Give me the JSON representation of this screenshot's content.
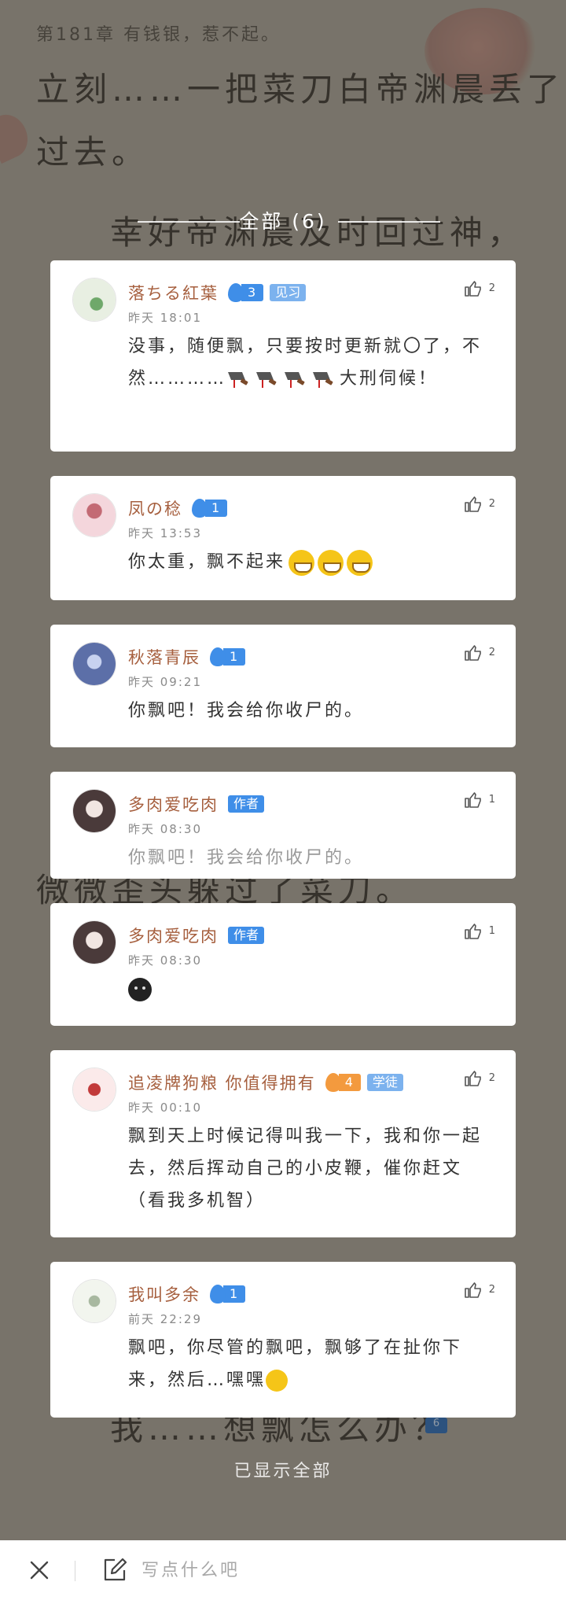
{
  "background": {
    "chapter": "第181章 有钱银，惹不起。",
    "lines": [
      "立刻……一把菜刀白帝渊晨丢了",
      "过去。",
      "幸好帝渊晨及时回过神，"
    ],
    "mid_lines": [
      "微微歪头躲过了菜刀。"
    ],
    "bottom_line": "我……想飘怎么办？",
    "badge_count": "6"
  },
  "header": {
    "title": "全部 (6)"
  },
  "comments": [
    {
      "name": "落ちる紅葉",
      "level": "3",
      "level_color": "blue",
      "tag": "见习",
      "tag_style": "light",
      "time": "昨天 18:01",
      "content": "没事，随便飘，只要按时更新就〇了，不然…………",
      "content_suffix": "大刑伺候！",
      "knives": 4,
      "likes": "2",
      "avatar_colors": [
        "#e8efe2",
        "#6fa86a"
      ]
    },
    {
      "name": "凤の稔",
      "level": "1",
      "level_color": "blue",
      "time": "昨天 13:53",
      "content": "你太重，飘不起来",
      "grins": 3,
      "likes": "2",
      "avatar_colors": [
        "#f4d6dc",
        "#c36a74"
      ]
    },
    {
      "name": "秋落青辰",
      "level": "1",
      "level_color": "blue",
      "time": "昨天 09:21",
      "content": "你飘吧！我会给你收尸的。",
      "likes": "2",
      "avatar_colors": [
        "#5c6fa8",
        "#c7d2f0"
      ]
    },
    {
      "name": "多肉爱吃肉",
      "tag": "作者",
      "tag_style": "author",
      "time": "昨天 08:30",
      "content": "你飘吧！我会给你收尸的。",
      "likes": "1",
      "avatar_colors": [
        "#f1e6e2",
        "#4a3a3a"
      ]
    },
    {
      "name": "多肉爱吃肉",
      "tag": "作者",
      "tag_style": "author",
      "time": "昨天 08:30",
      "content": "",
      "likes": "1",
      "avatar_colors": [
        "#f1e6e2",
        "#4a3a3a"
      ]
    },
    {
      "name": "追凌牌狗粮 你值得拥有",
      "level": "4",
      "level_color": "orange",
      "tag": "学徒",
      "tag_style": "light",
      "time": "昨天 00:10",
      "content": "飘到天上时候记得叫我一下，我和你一起去，然后挥动自己的小皮鞭，催你赶文（看我多机智）",
      "likes": "2",
      "avatar_colors": [
        "#fbeaea",
        "#c23a3a"
      ]
    },
    {
      "name": "我叫多余",
      "level": "1",
      "level_color": "blue",
      "time": "前天 22:29",
      "content": "飘吧，你尽管的飘吧，飘够了在扯你下来，然后…嘿嘿",
      "likes": "2",
      "avatar_colors": [
        "#f2f5ee",
        "#a8b8a0"
      ]
    }
  ],
  "footer_text": "已显示全部",
  "bottom_bar": {
    "placeholder": "写点什么吧"
  }
}
